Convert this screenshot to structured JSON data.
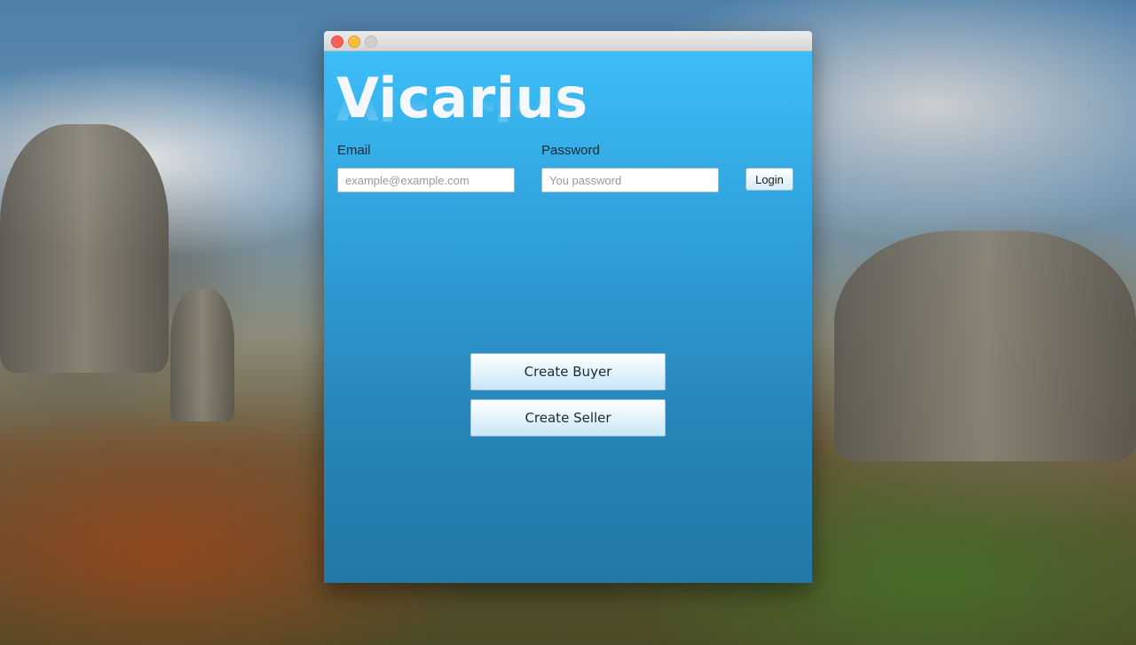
{
  "app": {
    "title": "Vicarius"
  },
  "login_form": {
    "email_label": "Email",
    "email_placeholder": "example@example.com",
    "email_value": "",
    "password_label": "Password",
    "password_placeholder": "You password",
    "password_value": "",
    "login_button": "Login"
  },
  "actions": {
    "create_buyer": "Create Buyer",
    "create_seller": "Create Seller"
  },
  "colors": {
    "content_top": "#3dbdf8",
    "content_bottom": "#2378a8",
    "close_button": "#fc605b",
    "minimize_button": "#fdbc40"
  }
}
